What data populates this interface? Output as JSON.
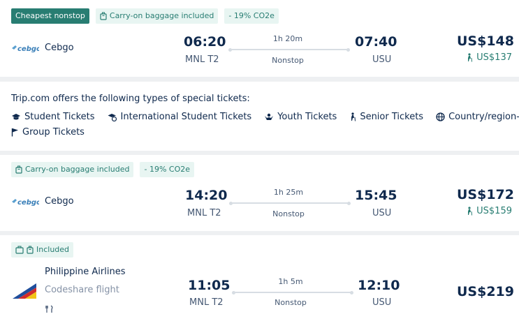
{
  "flights": [
    {
      "tags": [
        "Cheapest nonstop",
        "Carry-on baggage included",
        "- 19% CO2e"
      ],
      "airline": "Cebgo",
      "logo_text": "cebgo",
      "depart_time": "06:20",
      "depart_airport": "MNL T2",
      "duration": "1h 20m",
      "stops": "Nonstop",
      "arrive_time": "07:40",
      "arrive_airport": "USU",
      "price": "US$148",
      "senior_price": "US$137"
    },
    {
      "tags": [
        "Carry-on baggage included",
        "- 19% CO2e"
      ],
      "airline": "Cebgo",
      "logo_text": "cebgo",
      "depart_time": "14:20",
      "depart_airport": "MNL T2",
      "duration": "1h 25m",
      "stops": "Nonstop",
      "arrive_time": "15:45",
      "arrive_airport": "USU",
      "price": "US$172",
      "senior_price": "US$159"
    },
    {
      "tags": [
        "Included"
      ],
      "airline": "Philippine Airlines",
      "codeshare": "Codeshare flight",
      "depart_time": "11:05",
      "depart_airport": "MNL T2",
      "duration": "1h 5m",
      "stops": "Nonstop",
      "arrive_time": "12:10",
      "arrive_airport": "USU",
      "price": "US$219"
    }
  ],
  "special": {
    "title": "Trip.com offers the following types of special tickets:",
    "tickets": [
      "Student Tickets",
      "International Student Tickets",
      "Youth Tickets",
      "Senior Tickets",
      "Country/region-sp",
      "Group Tickets"
    ]
  },
  "colors": {
    "accent": "#287d72",
    "text": "#0f294d",
    "muted": "#455873"
  }
}
